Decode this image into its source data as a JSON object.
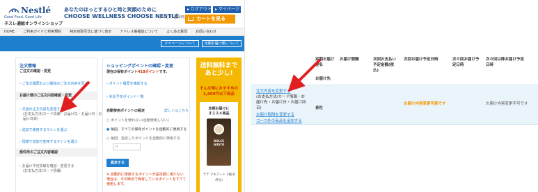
{
  "brand": {
    "name": "Nestlé",
    "katakana": "ネスレ",
    "tagline": "Good Food, Good Life",
    "shop": "ネスレ通販オンラインショップ"
  },
  "header": {
    "slogan_line1": "あなたのほっとするひと時と笑顔のために",
    "slogan_line2": "CHOOSE WELLNESS CHOOSE NESTLÉ",
    "welcome": "ようこそ 登録商品 さん",
    "logout": "ログアウト",
    "mypage": "マイページ",
    "cart": "カートを見る"
  },
  "nav": {
    "items": [
      "HOME",
      "ご利用ガイドと利用規約",
      "特定商取引法に基づく表示",
      "アドレス帳機能について",
      "よくある質問",
      "お問い合わせ"
    ]
  },
  "bluebar": {
    "btn_mypage": "マイページについて",
    "btn_regular": "定期お届け便について"
  },
  "order_panel": {
    "title": "注文情報",
    "subtitle": "ご注文の確認・変更",
    "link_history": "ご注文履歴および開始のご注文内容を見る",
    "section_regular": "お届け便のご注文内容確認・変更",
    "link_change_line1": "次回の注文内容を変更する",
    "link_change_line2": "(お支払方法/カード情報・お届け先・お届け日・お",
    "link_change_line3": "届け日目)",
    "link_add_machine": "追加で使用するマシンを選ぶ",
    "link_change_machine": "現場で追加で使用するマシンを選ぶ",
    "section_cancel": "部件改のご注文内容確認",
    "text_cancel_line1": "お届け予定情報を確認・変更する",
    "text_cancel_line2": "(お支払方法/カード情報)"
  },
  "points_panel": {
    "title": "ショッピングポイントの確認・変更",
    "current_label": "現在の保有ポイント",
    "current_value": "418ポイント",
    "current_suffix": "です。",
    "link_history": "ポイント履歴を確認する",
    "link_expiry": "失効予定ポイント一覧",
    "auto_use_title": "自動使用ポイントの設定",
    "auto_use_detail": "詳しくはこちら",
    "radio_none": "ポイントを使わない(自動使用しない)",
    "radio_all": "毎回、すべての保有ポイントを自動的に使用する",
    "radio_fixed": "毎回、指定したポイントを自動的に使用する",
    "input_value": "0",
    "set_button": "設定する",
    "note_line1": "※ 自動的に使用するポイントが設定額に満たない",
    "note_line2": "場合は、その時点で保有しているポイントをすべて",
    "note_line3": "使用します。"
  },
  "promo": {
    "headline_line1": "送料無料まで",
    "headline_line2": "あと少し!",
    "sub_line1": "そんな時におすすめの",
    "sub_line2": "1,000円以下商品",
    "card_line1": "定期お届けに",
    "card_line2": "オススメ商品",
    "product_label": "DOLCE GUSTO",
    "product_name_line1": "ラテ マキアート 1箱(8",
    "product_name_line2": "杯分)"
  },
  "table": {
    "headers": {
      "col1_line1": "定期お届け",
      "col1_line2": "便名",
      "col1_line3": "お届け先",
      "col2": "お届け間隔",
      "col3_line1": "次回お支払い",
      "col3_line2": "予定金額(税",
      "col3_line3": "込)",
      "col4": "次回お届け予定日時",
      "col5_line1": "次々回お届け予",
      "col5_line2": "定日時",
      "col6_line1": "次々回以降お届け予定",
      "col6_line2": "日時"
    },
    "row": {
      "link_change": "注文内容を変更する",
      "detail_line1": "(お支払方法/カード情報・お",
      "detail_line2": "届け先・お届け日・お届け回",
      "detail_line3": "日)",
      "company": "会社",
      "link_skip": "お届け間隔を変更する",
      "link_course": "コース外の商品を追加する",
      "status_changeable": "お届け内容変更可能です",
      "status_not_changeable": "お届け内容変更不可です"
    }
  },
  "colors": {
    "accent_blue": "#1f7fcf",
    "orange": "#f39800",
    "arrow": "#e02020"
  }
}
